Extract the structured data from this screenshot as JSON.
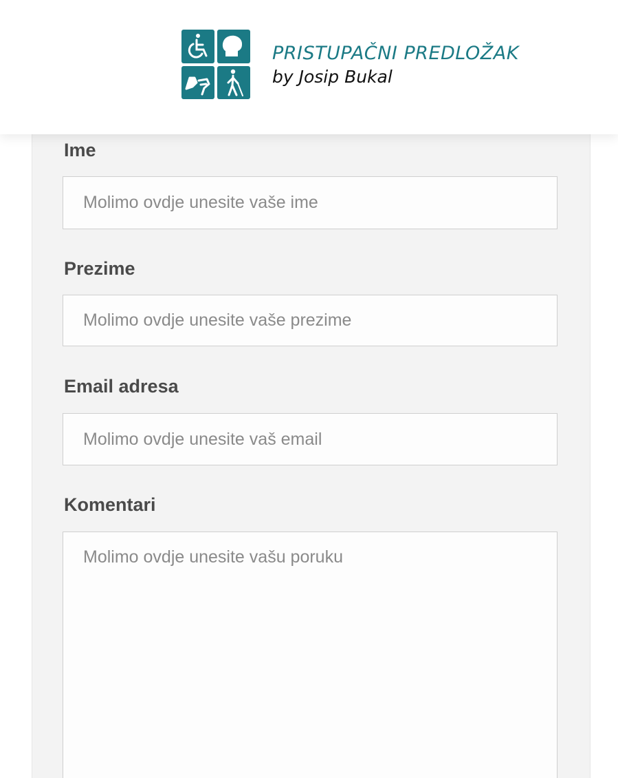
{
  "brand": {
    "title": "PRISTUPAČNI PREDLOŽAK",
    "subtitle": "by Josip Bukal",
    "logo_tile_color": "#1b7a85",
    "logo_icons": [
      "wheelchair-icon",
      "head-icon",
      "sign-language-icon",
      "blind-person-icon"
    ]
  },
  "form": {
    "fields": [
      {
        "label": "Ime",
        "placeholder": "Molimo ovdje unesite vaše ime",
        "value": ""
      },
      {
        "label": "Prezime",
        "placeholder": "Molimo ovdje unesite vaše prezime",
        "value": ""
      },
      {
        "label": "Email adresa",
        "placeholder": "Molimo ovdje unesite vaš email",
        "value": ""
      },
      {
        "label": "Komentari",
        "placeholder": "Molimo ovdje unesite vašu poruku",
        "value": ""
      }
    ]
  },
  "colors": {
    "accent": "#1b7a85",
    "panel_background": "#f3f3f3",
    "label_text": "#4a4a4a",
    "placeholder_text": "#8a8a8a"
  }
}
